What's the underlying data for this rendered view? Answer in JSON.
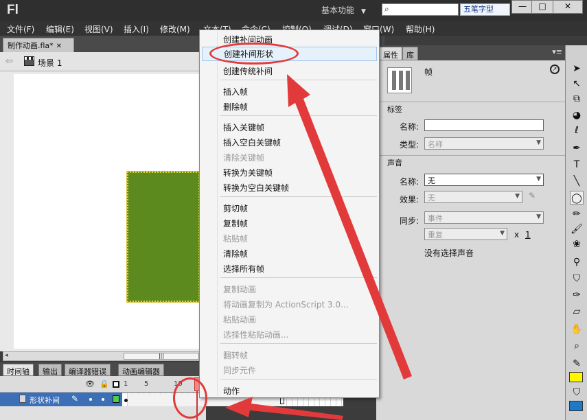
{
  "app": {
    "logo": "Fl",
    "workspace": "基本功能",
    "ime_label": "五笔字型",
    "window_buttons": [
      "—",
      "□",
      "✕"
    ]
  },
  "menubar": [
    "文件(F)",
    "编辑(E)",
    "视图(V)",
    "插入(I)",
    "修改(M)",
    "文本(T)",
    "命令(C)",
    "控制(O)",
    "调试(D)",
    "窗口(W)",
    "帮助(H)"
  ],
  "document": {
    "tab": "制作动画.fla*",
    "scene": "场景 1"
  },
  "timeline": {
    "tabs": [
      "时间轴",
      "输出",
      "编译器错误",
      "动画编辑器"
    ],
    "frame_numbers": [
      "1",
      "5",
      "10"
    ],
    "layer_name": "形状补间"
  },
  "properties": {
    "tabs": [
      "属性",
      "库"
    ],
    "frame_kind": "帧",
    "label_section": "标签",
    "name_label": "名称:",
    "type_label": "类型:",
    "type_value": "名称",
    "sound_section": "声音",
    "sound_name_label": "名称:",
    "sound_name_value": "无",
    "effect_label": "效果:",
    "effect_value": "无",
    "sync_label": "同步:",
    "sync_value": "事件",
    "repeat_value": "重复",
    "repeat_x": "x",
    "repeat_count": "1",
    "no_sound": "没有选择声音"
  },
  "context_menu": {
    "items": [
      {
        "label": "创建补间动画",
        "enabled": true
      },
      {
        "label": "创建补间形状",
        "enabled": true,
        "highlighted": true
      },
      {
        "label": "创建传统补间",
        "enabled": true
      },
      {
        "label": "插入帧",
        "enabled": true
      },
      {
        "label": "删除帧",
        "enabled": true
      },
      {
        "label": "插入关键帧",
        "enabled": true
      },
      {
        "label": "插入空白关键帧",
        "enabled": true
      },
      {
        "label": "清除关键帧",
        "enabled": false
      },
      {
        "label": "转换为关键帧",
        "enabled": true
      },
      {
        "label": "转换为空白关键帧",
        "enabled": true
      },
      {
        "label": "剪切帧",
        "enabled": true
      },
      {
        "label": "复制帧",
        "enabled": true
      },
      {
        "label": "粘贴帧",
        "enabled": false
      },
      {
        "label": "清除帧",
        "enabled": true
      },
      {
        "label": "选择所有帧",
        "enabled": true
      },
      {
        "label": "复制动画",
        "enabled": false
      },
      {
        "label": "将动画复制为 ActionScript 3.0...",
        "enabled": false
      },
      {
        "label": "粘贴动画",
        "enabled": false
      },
      {
        "label": "选择性粘贴动画...",
        "enabled": false
      },
      {
        "label": "翻转帧",
        "enabled": false
      },
      {
        "label": "同步元件",
        "enabled": false
      },
      {
        "label": "动作",
        "enabled": true
      }
    ]
  },
  "colors": {
    "shape_fill": "#5d8a1f",
    "annotation": "#e23a3a",
    "layer_highlight": "#3d6fb6"
  }
}
